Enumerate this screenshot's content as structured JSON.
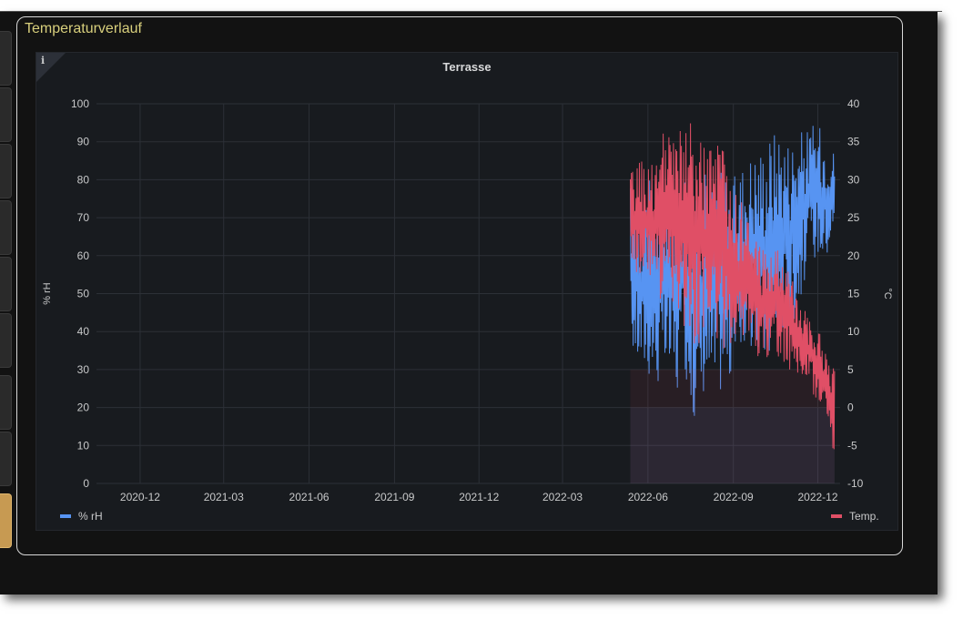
{
  "card": {
    "title": "Temperaturverlauf"
  },
  "info_icon": "info-icon",
  "colors": {
    "humidity": "#5794f2",
    "temperature": "#e04f66",
    "grid": "#2c3037",
    "text": "#c8c9ca"
  },
  "chart_data": {
    "type": "line",
    "title": "Terrasse",
    "x_ticks": [
      "2020-12",
      "2021-03",
      "2021-06",
      "2021-09",
      "2021-12",
      "2022-03",
      "2022-06",
      "2022-09",
      "2022-12"
    ],
    "xlim": [
      "2020-10-15",
      "2022-12-25"
    ],
    "y_left": {
      "label": "% rH",
      "lim": [
        0,
        100
      ],
      "ticks": [
        0,
        10,
        20,
        30,
        40,
        50,
        60,
        70,
        80,
        90,
        100
      ]
    },
    "y_right": {
      "label": "°C",
      "lim": [
        -10,
        40
      ],
      "ticks": [
        -10,
        -5,
        0,
        5,
        10,
        15,
        20,
        25,
        30,
        35,
        40
      ]
    },
    "series": [
      {
        "name": "% rH",
        "axis": "left",
        "color": "#5794f2",
        "data": [
          [
            "2022-05-13",
            35,
            80
          ],
          [
            "2022-05-23",
            30,
            75
          ],
          [
            "2022-06-02",
            28,
            80
          ],
          [
            "2022-06-12",
            25,
            78
          ],
          [
            "2022-06-22",
            28,
            80
          ],
          [
            "2022-07-02",
            22,
            82
          ],
          [
            "2022-07-12",
            28,
            85
          ],
          [
            "2022-07-22",
            15,
            75
          ],
          [
            "2022-08-01",
            25,
            82
          ],
          [
            "2022-08-11",
            22,
            80
          ],
          [
            "2022-08-21",
            25,
            85
          ],
          [
            "2022-08-31",
            27,
            80
          ],
          [
            "2022-09-10",
            35,
            85
          ],
          [
            "2022-09-20",
            35,
            88
          ],
          [
            "2022-09-30",
            30,
            90
          ],
          [
            "2022-10-10",
            32,
            93
          ],
          [
            "2022-10-20",
            38,
            95
          ],
          [
            "2022-10-30",
            40,
            92
          ],
          [
            "2022-11-09",
            45,
            93
          ],
          [
            "2022-11-19",
            55,
            94
          ],
          [
            "2022-11-29",
            60,
            95
          ],
          [
            "2022-12-09",
            58,
            93
          ],
          [
            "2022-12-19",
            65,
            88
          ]
        ]
      },
      {
        "name": "Temp.",
        "axis": "right",
        "color": "#e04f66",
        "data": [
          [
            "2022-05-13",
            18,
            31
          ],
          [
            "2022-05-23",
            17,
            33
          ],
          [
            "2022-06-02",
            17,
            32
          ],
          [
            "2022-06-12",
            14,
            35
          ],
          [
            "2022-06-22",
            13,
            37
          ],
          [
            "2022-07-02",
            12,
            36
          ],
          [
            "2022-07-12",
            10,
            39
          ],
          [
            "2022-07-22",
            8,
            36
          ],
          [
            "2022-08-01",
            9,
            35
          ],
          [
            "2022-08-11",
            10,
            36
          ],
          [
            "2022-08-21",
            7,
            34
          ],
          [
            "2022-08-31",
            8,
            29
          ],
          [
            "2022-09-10",
            9,
            27
          ],
          [
            "2022-09-20",
            7,
            24
          ],
          [
            "2022-09-30",
            6,
            22
          ],
          [
            "2022-10-10",
            6,
            21
          ],
          [
            "2022-10-20",
            6,
            22
          ],
          [
            "2022-10-30",
            5,
            18
          ],
          [
            "2022-11-09",
            4,
            16
          ],
          [
            "2022-11-19",
            2,
            14
          ],
          [
            "2022-11-29",
            1,
            11
          ],
          [
            "2022-12-09",
            -1,
            8
          ],
          [
            "2022-12-19",
            -7,
            5
          ]
        ]
      }
    ],
    "legend": {
      "left": "% rH",
      "right": "Temp."
    }
  }
}
